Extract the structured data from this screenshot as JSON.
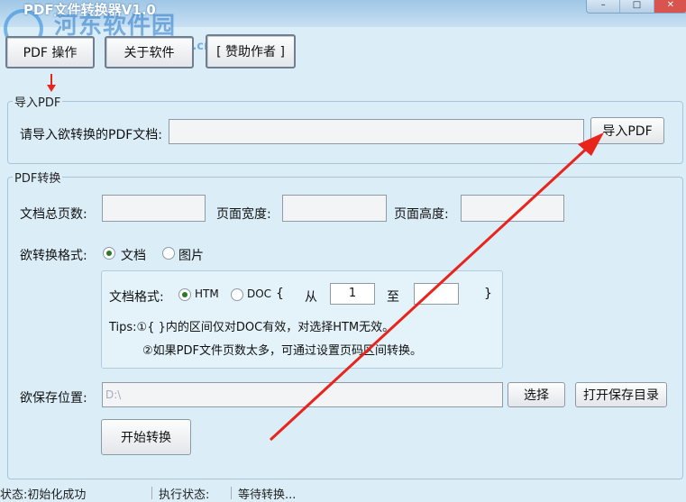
{
  "window": {
    "title": "PDF文件转换器V1.0",
    "watermark": "河东软件园",
    "watermark_url": "www.pc0359.cn"
  },
  "toolbar": {
    "operate_label": "PDF 操作",
    "about_label": "关于软件",
    "sponsor_label": "[ 赞助作者 ]"
  },
  "import_group": {
    "title": "导入PDF",
    "prompt": "请导入欲转换的PDF文档:",
    "path_value": "",
    "import_button": "导入PDF"
  },
  "convert_group": {
    "title": "PDF转换",
    "total_pages_label": "文档总页数:",
    "page_width_label": "页面宽度:",
    "page_height_label": "页面高度:",
    "total_pages_value": "",
    "page_width_value": "",
    "page_height_value": "",
    "format_label": "欲转换格式:",
    "format_options": [
      "文档",
      "图片"
    ],
    "format_selected": "文档",
    "doc_format_label": "文档格式:",
    "doc_format_options": [
      "HTM",
      "DOC"
    ],
    "doc_format_selected": "HTM",
    "brace_open": "{",
    "from_label": "从",
    "from_value": "1",
    "to_label": "至",
    "to_value": "",
    "brace_close": "}",
    "tip1": "Tips:①{ }内的区间仅对DOC有效，对选择HTM无效。",
    "tip2": "②如果PDF文件页数太多，可通过设置页码区间转换。",
    "save_label": "欲保存位置:",
    "save_path_placeholder": "D:\\",
    "select_button": "选择",
    "open_dir_button": "打开保存目录",
    "start_button": "开始转换"
  },
  "statusbar": {
    "status": "状态:初始化成功",
    "exec_label": "执行状态:",
    "exec_value": "等待转换..."
  },
  "colors": {
    "background": "#dbeef8",
    "annotation_arrow": "#e8241c"
  }
}
